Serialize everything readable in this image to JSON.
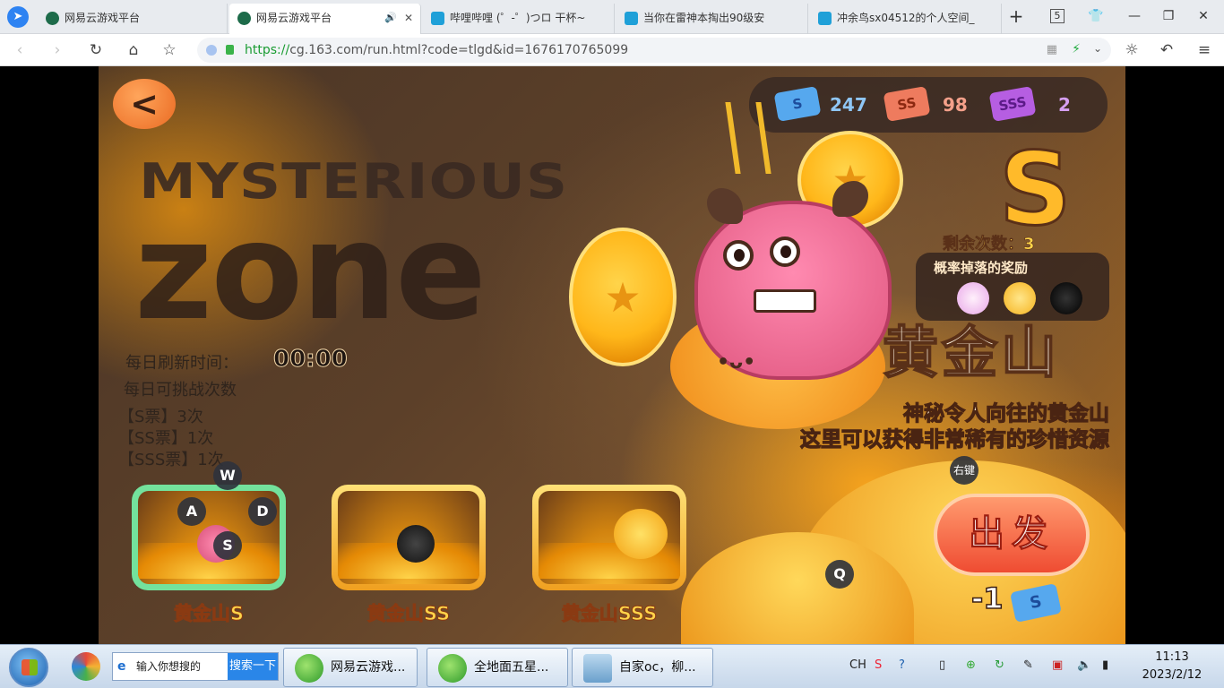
{
  "browser": {
    "tabs": [
      {
        "title": "网易云游戏平台",
        "active": false
      },
      {
        "title": "网易云游戏平台",
        "active": true
      },
      {
        "title": "哔哩哔哩 (゜-゜)つロ 干杯~",
        "active": false
      },
      {
        "title": "当你在雷神本掏出90级安",
        "active": false
      },
      {
        "title": "冲余鸟sx04512的个人空间_",
        "active": false
      }
    ],
    "tab_count": "5",
    "url_scheme": "https://",
    "url_rest": "cg.163.com/run.html?code=tlgd&id=1676170765099"
  },
  "game": {
    "back_label": "<",
    "title_line1": "MYSTERIOUS",
    "title_line2": "zone",
    "refresh_label": "每日刷新时间：",
    "refresh_time": "00:00",
    "challenge_label": "每日可挑战次数",
    "ticket_limits": [
      "【S票】3次",
      "【SS票】1次",
      "【SSS票】1次"
    ],
    "currency": [
      {
        "ticket": "S",
        "count": "247",
        "color": "#56a8ee"
      },
      {
        "ticket": "SS",
        "count": "98",
        "color": "#ee7b5e"
      },
      {
        "ticket": "SSS",
        "count": "2",
        "color": "#b65ee2"
      }
    ],
    "grade": "S",
    "remaining": "剩余次数：3",
    "rewards_label": "概率掉落的奖励",
    "zone_name": "黄金山",
    "desc_line1": "神秘令人向往的黄金山",
    "desc_line2": "这里可以获得非常稀有的珍惜资源",
    "levels": [
      {
        "label": "黄金山S",
        "selected": true
      },
      {
        "label": "黄金山SS",
        "selected": false
      },
      {
        "label": "黄金山SSS",
        "selected": false
      }
    ],
    "key_hints": {
      "w": "W",
      "a": "A",
      "s": "S",
      "d": "D",
      "q": "Q",
      "right": "右键"
    },
    "go_label": "出发",
    "cost": "-1",
    "cost_ticket": "S"
  },
  "taskbar": {
    "search_placeholder": "输入你想搜的",
    "search_button": "搜索一下",
    "tasks": [
      "网易云游戏...",
      "全地面五星...",
      "自家oc，柳..."
    ],
    "ime": "CH",
    "time": "11:13",
    "date": "2023/2/12"
  }
}
